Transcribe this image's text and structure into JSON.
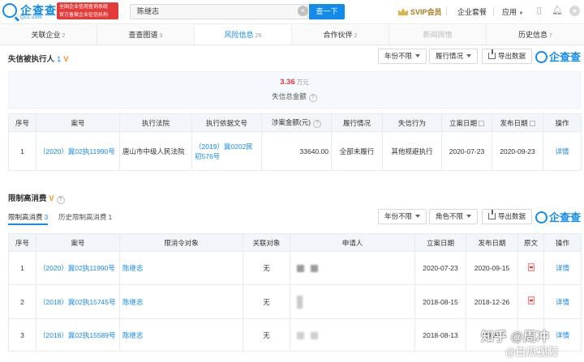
{
  "header": {
    "logo_text": "企查查",
    "logo_sub": "Qcc.com",
    "slogan_line1": "全国企业信用查询系统",
    "slogan_line2": "官方备案企业征信机构",
    "search_value": "陈继志",
    "search_button": "查一下",
    "svip_label": "SVIP会员",
    "nav_items": [
      "企业套餐",
      "应用"
    ]
  },
  "tabs": [
    {
      "label": "关联企业",
      "count": "2",
      "state": "normal"
    },
    {
      "label": "查查图谱",
      "count": "3",
      "state": "normal"
    },
    {
      "label": "风险信息",
      "count": "26",
      "state": "active"
    },
    {
      "label": "合作伙伴",
      "count": "2",
      "state": "normal"
    },
    {
      "label": "新闻舆情",
      "count": "",
      "state": "disabled"
    },
    {
      "label": "历史信息",
      "count": "7",
      "state": "normal"
    }
  ],
  "dishonest": {
    "title": "失信被执行人",
    "count": "1",
    "filters": [
      "年份不限",
      "履行情况"
    ],
    "export_label": "导出数据",
    "watermark_text": "企查查",
    "summary_amount": "3.36",
    "summary_unit": "万元",
    "summary_label": "失信总金额",
    "columns": [
      "序号",
      "案号",
      "执行法院",
      "执行依据文号",
      "涉案金额(元)",
      "履行情况",
      "失信行为",
      "立案日期",
      "发布日期",
      "操作"
    ],
    "rows": [
      {
        "index": "1",
        "case_no": "（2020）冀02执11990号",
        "court": "唐山市中级人民法院",
        "basis_no": "（2019）冀0202民初576号",
        "amount": "33640.00",
        "status": "全部未履行",
        "behavior": "其他规避执行",
        "filed_date": "2020-07-23",
        "publish_date": "2020-09-23",
        "action": "详情"
      }
    ]
  },
  "restriction": {
    "title": "限制高消费",
    "subtabs": [
      {
        "label": "限制高消费",
        "count": "3"
      },
      {
        "label": "历史限制高消费",
        "count": "1"
      }
    ],
    "filters": [
      "年份不限",
      "角色不限"
    ],
    "export_label": "导出数据",
    "watermark_text": "企查查",
    "columns": [
      "序号",
      "案号",
      "限消令对象",
      "关联对象",
      "申请人",
      "立案日期",
      "发布日期",
      "原文",
      "操作"
    ],
    "rows": [
      {
        "index": "1",
        "case_no": "（2020）冀02执11990号",
        "target": "陈继志",
        "related": "无",
        "filed_date": "2020-07-23",
        "publish_date": "2020-09-15",
        "action": "详情"
      },
      {
        "index": "2",
        "case_no": "（2018）冀02执15745号",
        "target": "陈继志",
        "related": "无",
        "filed_date": "2018-08-15",
        "publish_date": "2018-12-26",
        "action": "详情"
      },
      {
        "index": "3",
        "case_no": "（2018）冀02执15589号",
        "target": "陈继志",
        "related": "无",
        "filed_date": "2018-08-13",
        "publish_date": "2018-",
        "action": "详情"
      }
    ]
  },
  "watermark": {
    "line1": "知乎 @周冲",
    "line2": "@白瓜视频"
  },
  "colors": {
    "brand": "#128bed",
    "alert": "#e33a3a",
    "accent": "#f48c1e"
  }
}
